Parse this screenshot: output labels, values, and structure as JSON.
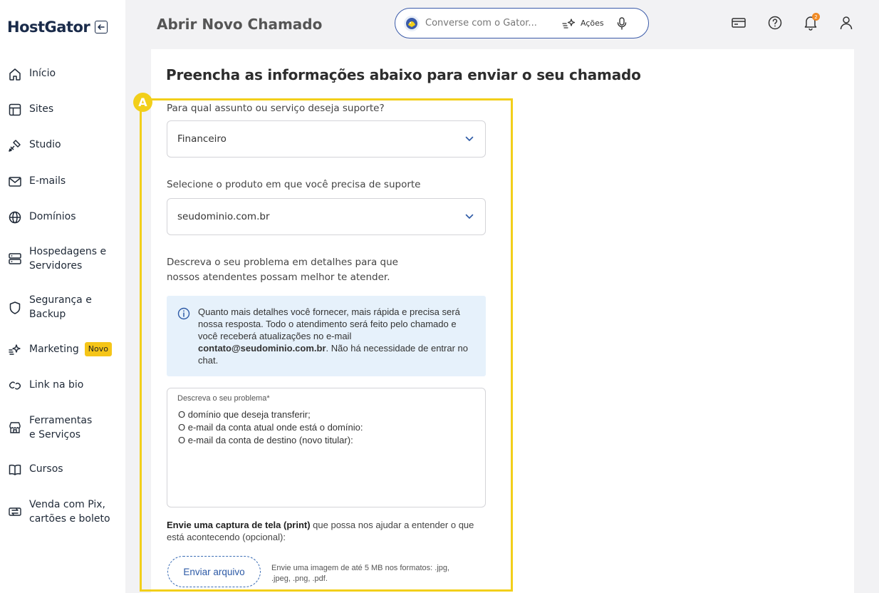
{
  "brand": {
    "name": "HostGator"
  },
  "sidebar": {
    "items": [
      {
        "label": "Início",
        "icon": "home-icon"
      },
      {
        "label": "Sites",
        "icon": "layout-icon"
      },
      {
        "label": "Studio",
        "icon": "paint-tools-icon"
      },
      {
        "label": "E-mails",
        "icon": "mail-icon"
      },
      {
        "label": "Domínios",
        "icon": "globe-icon"
      },
      {
        "label": "Hospedagens e Servidores",
        "icon": "server-icon"
      },
      {
        "label": "Segurança e Backup",
        "icon": "shield-icon"
      },
      {
        "label": "Marketing",
        "icon": "sparkle-icon",
        "badge": "Novo"
      },
      {
        "label": "Link na bio",
        "icon": "link-icon"
      },
      {
        "label": "Ferramentas e Serviços",
        "icon": "store-icon"
      },
      {
        "label": "Cursos",
        "icon": "book-icon"
      },
      {
        "label": "Venda com Pix, cartões e boleto",
        "icon": "transfer-icon"
      }
    ]
  },
  "header": {
    "title": "Abrir Novo Chamado",
    "assistant_placeholder": "Converse com o Gator...",
    "actions_label": "Ações"
  },
  "notifications": {
    "count": "2"
  },
  "form": {
    "title": "Preencha as informações abaixo para enviar o seu chamado",
    "marker": "A",
    "subject_label": "Para qual assunto ou serviço deseja suporte?",
    "subject_value": "Financeiro",
    "product_label": "Selecione o produto em que você precisa de suporte",
    "product_value": "seudominio.com.br",
    "describe_intro": "Descreva o seu problema em detalhes para que nossos atendentes possam melhor te atender.",
    "info_text_1": "Quanto mais detalhes você fornecer, mais rápida e precisa será nossa resposta. Todo o atendimento será feito pelo chamado e você receberá atualizações no e-mail ",
    "info_email": "contato@seudominio.com.br",
    "info_text_2": ". Não há necessidade de entrar no chat.",
    "problem_label": "Descreva o seu problema*",
    "problem_value": "O domínio que deseja transferir;\nO e-mail da conta atual onde está o domínio:\nO e-mail da conta de destino (novo titular):",
    "upload_bold": "Envie uma captura de tela (print)",
    "upload_rest": " que possa nos ajudar a entender o que está acontecendo (opcional):",
    "upload_button": "Enviar arquivo",
    "upload_hint": "Envie uma imagem de até 5 MB nos formatos: .jpg, .jpeg, .png, .pdf."
  },
  "colors": {
    "highlight": "#f2cf1a",
    "primary": "#2d5aa6",
    "info_bg": "#e6f1fb"
  }
}
